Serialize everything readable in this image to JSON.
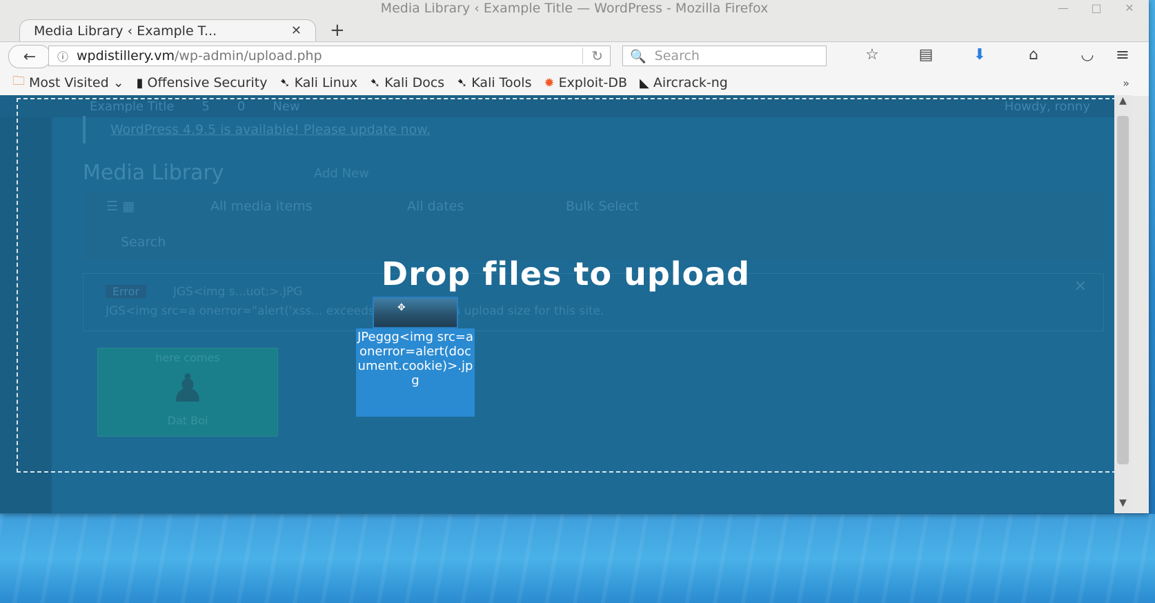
{
  "window": {
    "title": "Media Library ‹ Example Title — WordPress - Mozilla Firefox",
    "controls": [
      "minimize",
      "maximize",
      "close"
    ]
  },
  "tab": {
    "title": "Media Library ‹ Example T...",
    "close": "✕",
    "new": "+"
  },
  "navbar": {
    "url_host": "wpdistillery.vm",
    "url_path": "/wp-admin/upload.php",
    "search_placeholder": "Search",
    "icons": [
      "star-icon",
      "reading-list-icon",
      "download-icon",
      "home-icon",
      "pocket-icon",
      "menu-icon"
    ]
  },
  "bookmarks": {
    "items": [
      {
        "label": "Most Visited",
        "icon": "folder-icon"
      },
      {
        "label": "Offensive Security",
        "icon": "offsec-icon"
      },
      {
        "label": "Kali Linux",
        "icon": "kali-icon"
      },
      {
        "label": "Kali Docs",
        "icon": "kali-icon"
      },
      {
        "label": "Kali Tools",
        "icon": "kali-icon"
      },
      {
        "label": "Exploit-DB",
        "icon": "exploitdb-icon"
      },
      {
        "label": "Aircrack-ng",
        "icon": "aircrack-icon"
      }
    ],
    "more": "»"
  },
  "wp": {
    "adminbar": {
      "site": "Example Title",
      "updates": "5",
      "comments": "0",
      "new": "New",
      "howdy": "Howdy, ronny"
    },
    "notice": "WordPress 4.9.5 is available! Please update now.",
    "heading": "Media Library",
    "add_new": "Add New",
    "filters": {
      "media": "All media items",
      "dates": "All dates",
      "bulk": "Bulk Select",
      "search": "Search"
    },
    "error": {
      "badge": "Error",
      "line1": "JGS<img s...uot;>.JPG",
      "line2": "JGS<img src=a onerror=\"alert('xss...   exceeds the maximum upload size for this site."
    },
    "thumb": {
      "caption_top": "here comes",
      "caption_bottom": "Dat Boi"
    }
  },
  "dropzone": {
    "title": "Drop files to upload",
    "dragged_file": "JPeggg<img src=a onerror=alert(document.cookie)>.jpg"
  }
}
